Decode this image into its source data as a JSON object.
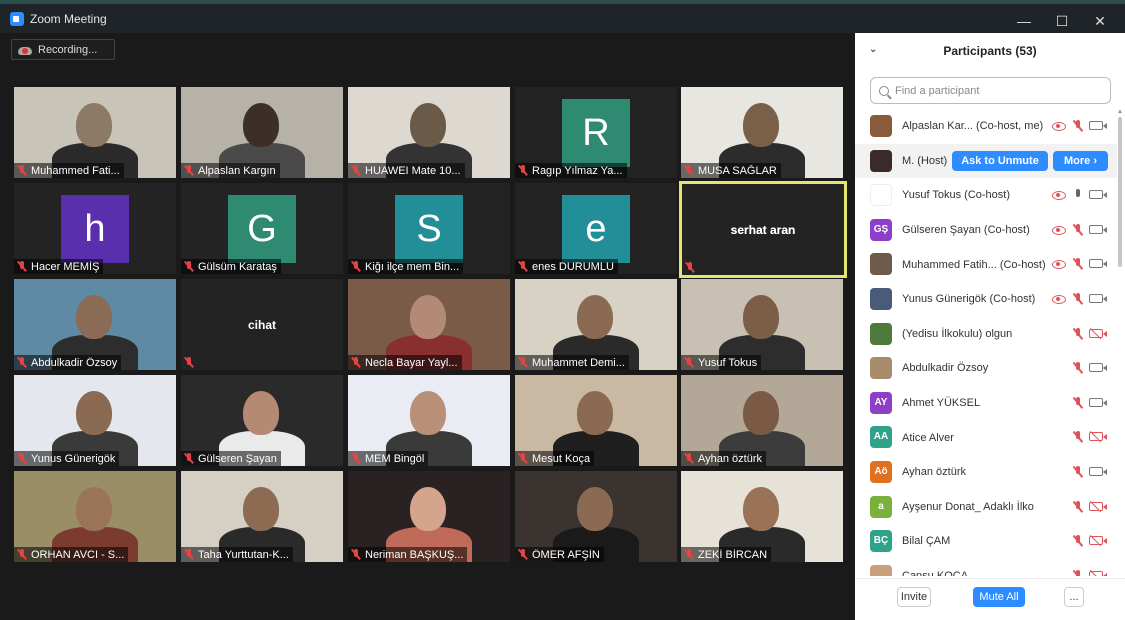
{
  "window": {
    "title": "Zoom Meeting",
    "controls": [
      "—",
      "☐",
      "✕"
    ]
  },
  "recording": {
    "label": "Recording..."
  },
  "tiles": [
    {
      "name": "Muhammed Fati..."
    },
    {
      "name": "Alpaslan Kargın"
    },
    {
      "name": "HUAWEI Mate 10..."
    },
    {
      "name": "Ragıp Yılmaz  Ya...",
      "avatar_letter": "R",
      "avatar_color": "#2e8b72"
    },
    {
      "name": "MUSA SAĞLAR"
    },
    {
      "name": "Hacer MEMİŞ",
      "avatar_letter": "h",
      "avatar_color": "#5a2fae"
    },
    {
      "name": "Gülsüm Karataş",
      "avatar_letter": "G",
      "avatar_color": "#2e8b72"
    },
    {
      "name": "Kiğı ilçe mem Bin...",
      "avatar_letter": "S",
      "avatar_color": "#228e97"
    },
    {
      "name": "enes DURUMLU",
      "avatar_letter": "e",
      "avatar_color": "#228e97"
    },
    {
      "name": "serhat aran",
      "active": true
    },
    {
      "name": "Abdulkadir Özsoy"
    },
    {
      "name": "cihat"
    },
    {
      "name": "Necla Bayar Yayl..."
    },
    {
      "name": "Muhammet Demi..."
    },
    {
      "name": "Yusuf Tokus"
    },
    {
      "name": "Yunus Günerigök"
    },
    {
      "name": "Gülseren Şayan"
    },
    {
      "name": "MEM Bingöl"
    },
    {
      "name": "Mesut Koça"
    },
    {
      "name": "Ayhan öztürk"
    },
    {
      "name": "ORHAN AVCI - S..."
    },
    {
      "name": "Taha Yurttutan-K..."
    },
    {
      "name": "Neriman BAŞKUŞ..."
    },
    {
      "name": "ÖMER AFŞİN"
    },
    {
      "name": "ZEKİ BİRCAN"
    }
  ],
  "participants": {
    "title": "Participants (53)",
    "search_placeholder": "Find a participant",
    "list": [
      {
        "name": "Alpaslan Kar...  (Co-host, me)",
        "avatar": "",
        "avatar_color": "#8a5a3c",
        "eye": true,
        "mic": "off",
        "cam": "on"
      },
      {
        "name": "M. (Host)",
        "avatar": "",
        "avatar_color": "#3b2a2a",
        "host": true
      },
      {
        "name": "Yusuf Tokus (Co-host)",
        "avatar": "",
        "avatar_color": "#ffffff",
        "eye": true,
        "mic": "on",
        "cam": "on"
      },
      {
        "name": "Gülseren Şayan (Co-host)",
        "avatar": "GŞ",
        "avatar_color": "#8e3fc9",
        "eye": true,
        "mic": "off",
        "cam": "on"
      },
      {
        "name": "Muhammed Fatih...  (Co-host)",
        "avatar": "",
        "avatar_color": "#6e5a4a",
        "eye": true,
        "mic": "off",
        "cam": "on"
      },
      {
        "name": "Yunus Günerigök (Co-host)",
        "avatar": "",
        "avatar_color": "#4a5b7a",
        "eye": true,
        "mic": "off",
        "cam": "on"
      },
      {
        "name": "(Yedisu İlkokulu) olgun",
        "avatar": "",
        "avatar_color": "#4f7a3e",
        "mic": "off",
        "cam": "off"
      },
      {
        "name": "Abdulkadir Özsoy",
        "avatar": "",
        "avatar_color": "#a88c6a",
        "mic": "off",
        "cam": "on"
      },
      {
        "name": "Ahmet YÜKSEL",
        "avatar": "AY",
        "avatar_color": "#8e3fc9",
        "mic": "off",
        "cam": "on"
      },
      {
        "name": "Atice Alver",
        "avatar": "AA",
        "avatar_color": "#2ea389",
        "mic": "off",
        "cam": "off"
      },
      {
        "name": "Ayhan öztürk",
        "avatar": "Aö",
        "avatar_color": "#e0701f",
        "mic": "off",
        "cam": "on"
      },
      {
        "name": "Ayşenur Donat_ Adaklı İlko",
        "avatar": "a",
        "avatar_color": "#7ab03c",
        "mic": "off",
        "cam": "off"
      },
      {
        "name": "Bilal ÇAM",
        "avatar": "BÇ",
        "avatar_color": "#2ea389",
        "mic": "off",
        "cam": "off"
      },
      {
        "name": "Cansu KOÇA",
        "avatar": "",
        "avatar_color": "#c9a07a",
        "mic": "off",
        "cam": "off"
      }
    ],
    "host_actions": {
      "unmute": "Ask to Unmute",
      "more": "More ›"
    },
    "footer": {
      "invite": "Invite",
      "mute_all": "Mute All",
      "more": "..."
    }
  }
}
